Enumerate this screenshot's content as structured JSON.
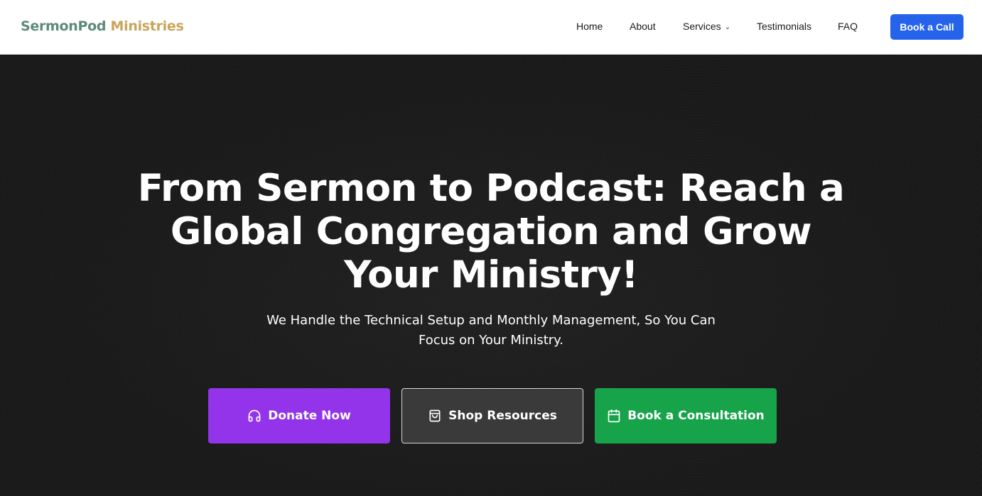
{
  "header": {
    "logo": {
      "part1": "SermonPod",
      "part2": "Ministries"
    },
    "nav": {
      "home": "Home",
      "about": "About",
      "services": "Services",
      "testimonials": "Testimonials",
      "faq": "FAQ"
    },
    "cta_label": "Book a Call"
  },
  "hero": {
    "title": "From Sermon to Podcast: Reach a Global Congregation and Grow Your Ministry!",
    "subtitle_line1": "We Handle the Technical Setup and Monthly Management, So You Can",
    "subtitle_line2": "Focus on Your Ministry.",
    "buttons": {
      "donate": {
        "label": "Donate Now",
        "icon": "headphones-icon"
      },
      "shop": {
        "label": "Shop Resources",
        "icon": "shopping-bag-icon"
      },
      "consult": {
        "label": "Book a Consultation",
        "icon": "calendar-icon"
      }
    }
  },
  "colors": {
    "logo_primary": "#5b8a7a",
    "logo_accent": "#c9a45c",
    "call_button": "#2563eb",
    "donate_button": "#9333ea",
    "shop_button": "#3a3a3a",
    "consult_button": "#16a34a",
    "hero_background": "#181818"
  }
}
